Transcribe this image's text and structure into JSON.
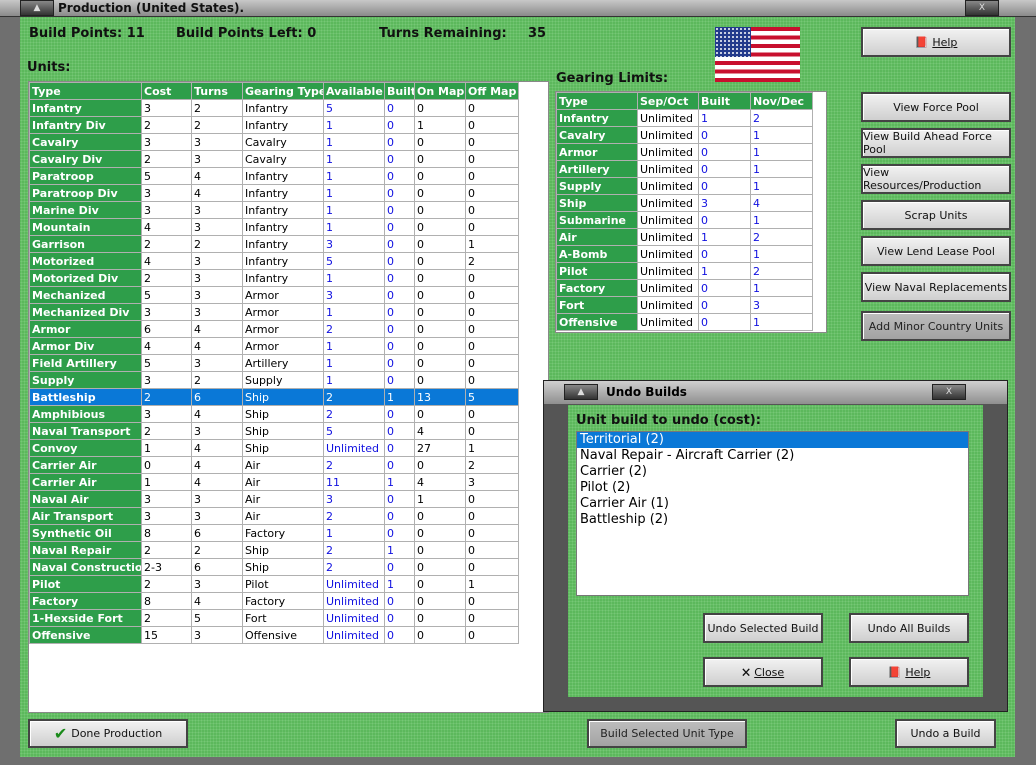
{
  "window": {
    "title": "Production (United States)."
  },
  "header": {
    "build_points": "Build Points: 11",
    "build_points_left": "Build Points Left:  0",
    "turns_remaining_label": "Turns Remaining:",
    "turns_remaining": "35"
  },
  "units": {
    "label": "Units:",
    "columns": [
      "Type",
      "Cost",
      "Turns",
      "Gearing Type",
      "Available",
      "Built",
      "On Map",
      "Off Map"
    ],
    "selected_index": 17,
    "rows": [
      [
        "Infantry",
        "3",
        "2",
        "Infantry",
        "5",
        "0",
        "0",
        "0"
      ],
      [
        "Infantry Div",
        "2",
        "2",
        "Infantry",
        "1",
        "0",
        "1",
        "0"
      ],
      [
        "Cavalry",
        "3",
        "3",
        "Cavalry",
        "1",
        "0",
        "0",
        "0"
      ],
      [
        "Cavalry Div",
        "2",
        "3",
        "Cavalry",
        "1",
        "0",
        "0",
        "0"
      ],
      [
        "Paratroop",
        "5",
        "4",
        "Infantry",
        "1",
        "0",
        "0",
        "0"
      ],
      [
        "Paratroop Div",
        "3",
        "4",
        "Infantry",
        "1",
        "0",
        "0",
        "0"
      ],
      [
        "Marine Div",
        "3",
        "3",
        "Infantry",
        "1",
        "0",
        "0",
        "0"
      ],
      [
        "Mountain",
        "4",
        "3",
        "Infantry",
        "1",
        "0",
        "0",
        "0"
      ],
      [
        "Garrison",
        "2",
        "2",
        "Infantry",
        "3",
        "0",
        "0",
        "1"
      ],
      [
        "Motorized",
        "4",
        "3",
        "Infantry",
        "5",
        "0",
        "0",
        "2"
      ],
      [
        "Motorized Div",
        "2",
        "3",
        "Infantry",
        "1",
        "0",
        "0",
        "0"
      ],
      [
        "Mechanized",
        "5",
        "3",
        "Armor",
        "3",
        "0",
        "0",
        "0"
      ],
      [
        "Mechanized Div",
        "3",
        "3",
        "Armor",
        "1",
        "0",
        "0",
        "0"
      ],
      [
        "Armor",
        "6",
        "4",
        "Armor",
        "2",
        "0",
        "0",
        "0"
      ],
      [
        "Armor Div",
        "4",
        "4",
        "Armor",
        "1",
        "0",
        "0",
        "0"
      ],
      [
        "Field Artillery",
        "5",
        "3",
        "Artillery",
        "1",
        "0",
        "0",
        "0"
      ],
      [
        "Supply",
        "3",
        "2",
        "Supply",
        "1",
        "0",
        "0",
        "0"
      ],
      [
        "Battleship",
        "2",
        "6",
        "Ship",
        "2",
        "1",
        "13",
        "5"
      ],
      [
        "Amphibious",
        "3",
        "4",
        "Ship",
        "2",
        "0",
        "0",
        "0"
      ],
      [
        "Naval Transport",
        "2",
        "3",
        "Ship",
        "5",
        "0",
        "4",
        "0"
      ],
      [
        "Convoy",
        "1",
        "4",
        "Ship",
        "Unlimited",
        "0",
        "27",
        "1"
      ],
      [
        "Carrier Air",
        "0",
        "4",
        "Air",
        "2",
        "0",
        "0",
        "2"
      ],
      [
        "Carrier Air",
        "1",
        "4",
        "Air",
        "11",
        "1",
        "4",
        "3"
      ],
      [
        "Naval Air",
        "3",
        "3",
        "Air",
        "3",
        "0",
        "1",
        "0"
      ],
      [
        "Air Transport",
        "3",
        "3",
        "Air",
        "2",
        "0",
        "0",
        "0"
      ],
      [
        "Synthetic Oil",
        "8",
        "6",
        "Factory",
        "1",
        "0",
        "0",
        "0"
      ],
      [
        "Naval Repair",
        "2",
        "2",
        "Ship",
        "2",
        "1",
        "0",
        "0"
      ],
      [
        "Naval Construction",
        "2-3",
        "6",
        "Ship",
        "2",
        "0",
        "0",
        "0"
      ],
      [
        "Pilot",
        "2",
        "3",
        "Pilot",
        "Unlimited",
        "1",
        "0",
        "1"
      ],
      [
        "Factory",
        "8",
        "4",
        "Factory",
        "Unlimited",
        "0",
        "0",
        "0"
      ],
      [
        "1-Hexside Fort",
        "2",
        "5",
        "Fort",
        "Unlimited",
        "0",
        "0",
        "0"
      ],
      [
        "Offensive",
        "15",
        "3",
        "Offensive",
        "Unlimited",
        "0",
        "0",
        "0"
      ]
    ]
  },
  "gearing": {
    "label": "Gearing Limits:",
    "columns": [
      "Type",
      "Sep/Oct",
      "Built",
      "Nov/Dec"
    ],
    "rows": [
      [
        "Infantry",
        "Unlimited",
        "1",
        "2"
      ],
      [
        "Cavalry",
        "Unlimited",
        "0",
        "1"
      ],
      [
        "Armor",
        "Unlimited",
        "0",
        "1"
      ],
      [
        "Artillery",
        "Unlimited",
        "0",
        "1"
      ],
      [
        "Supply",
        "Unlimited",
        "0",
        "1"
      ],
      [
        "Ship",
        "Unlimited",
        "3",
        "4"
      ],
      [
        "Submarine",
        "Unlimited",
        "0",
        "1"
      ],
      [
        "Air",
        "Unlimited",
        "1",
        "2"
      ],
      [
        "A-Bomb",
        "Unlimited",
        "0",
        "1"
      ],
      [
        "Pilot",
        "Unlimited",
        "1",
        "2"
      ],
      [
        "Factory",
        "Unlimited",
        "0",
        "1"
      ],
      [
        "Fort",
        "Unlimited",
        "0",
        "3"
      ],
      [
        "Offensive",
        "Unlimited",
        "0",
        "1"
      ]
    ]
  },
  "buttons": {
    "help": "Help",
    "view_force_pool": "View Force Pool",
    "view_build_ahead": "View Build Ahead Force Pool",
    "view_resources": "View Resources/Production",
    "scrap_units": "Scrap Units",
    "view_lend_lease": "View Lend Lease Pool",
    "view_naval_replacements": "View Naval Replacements",
    "add_minor": "Add Minor Country Units",
    "done_production": "Done Production",
    "build_selected": "Build Selected Unit Type",
    "undo_a_build": "Undo a Build"
  },
  "undo_dialog": {
    "title": "Undo Builds",
    "label": "Unit build to undo (cost):",
    "selected_index": 0,
    "items": [
      "Territorial (2)",
      "Naval Repair - Aircraft Carrier (2)",
      "Carrier (2)",
      "Pilot (2)",
      "Carrier Air (1)",
      "Battleship (2)"
    ],
    "undo_selected": "Undo Selected Build",
    "undo_all": "Undo All Builds",
    "close": "Close",
    "help": "Help"
  },
  "colors": {
    "header_green": "#2e9e4a",
    "background_green": "#5cb85c",
    "selection_blue": "#0a78d7",
    "value_blue": "#1010e0"
  }
}
